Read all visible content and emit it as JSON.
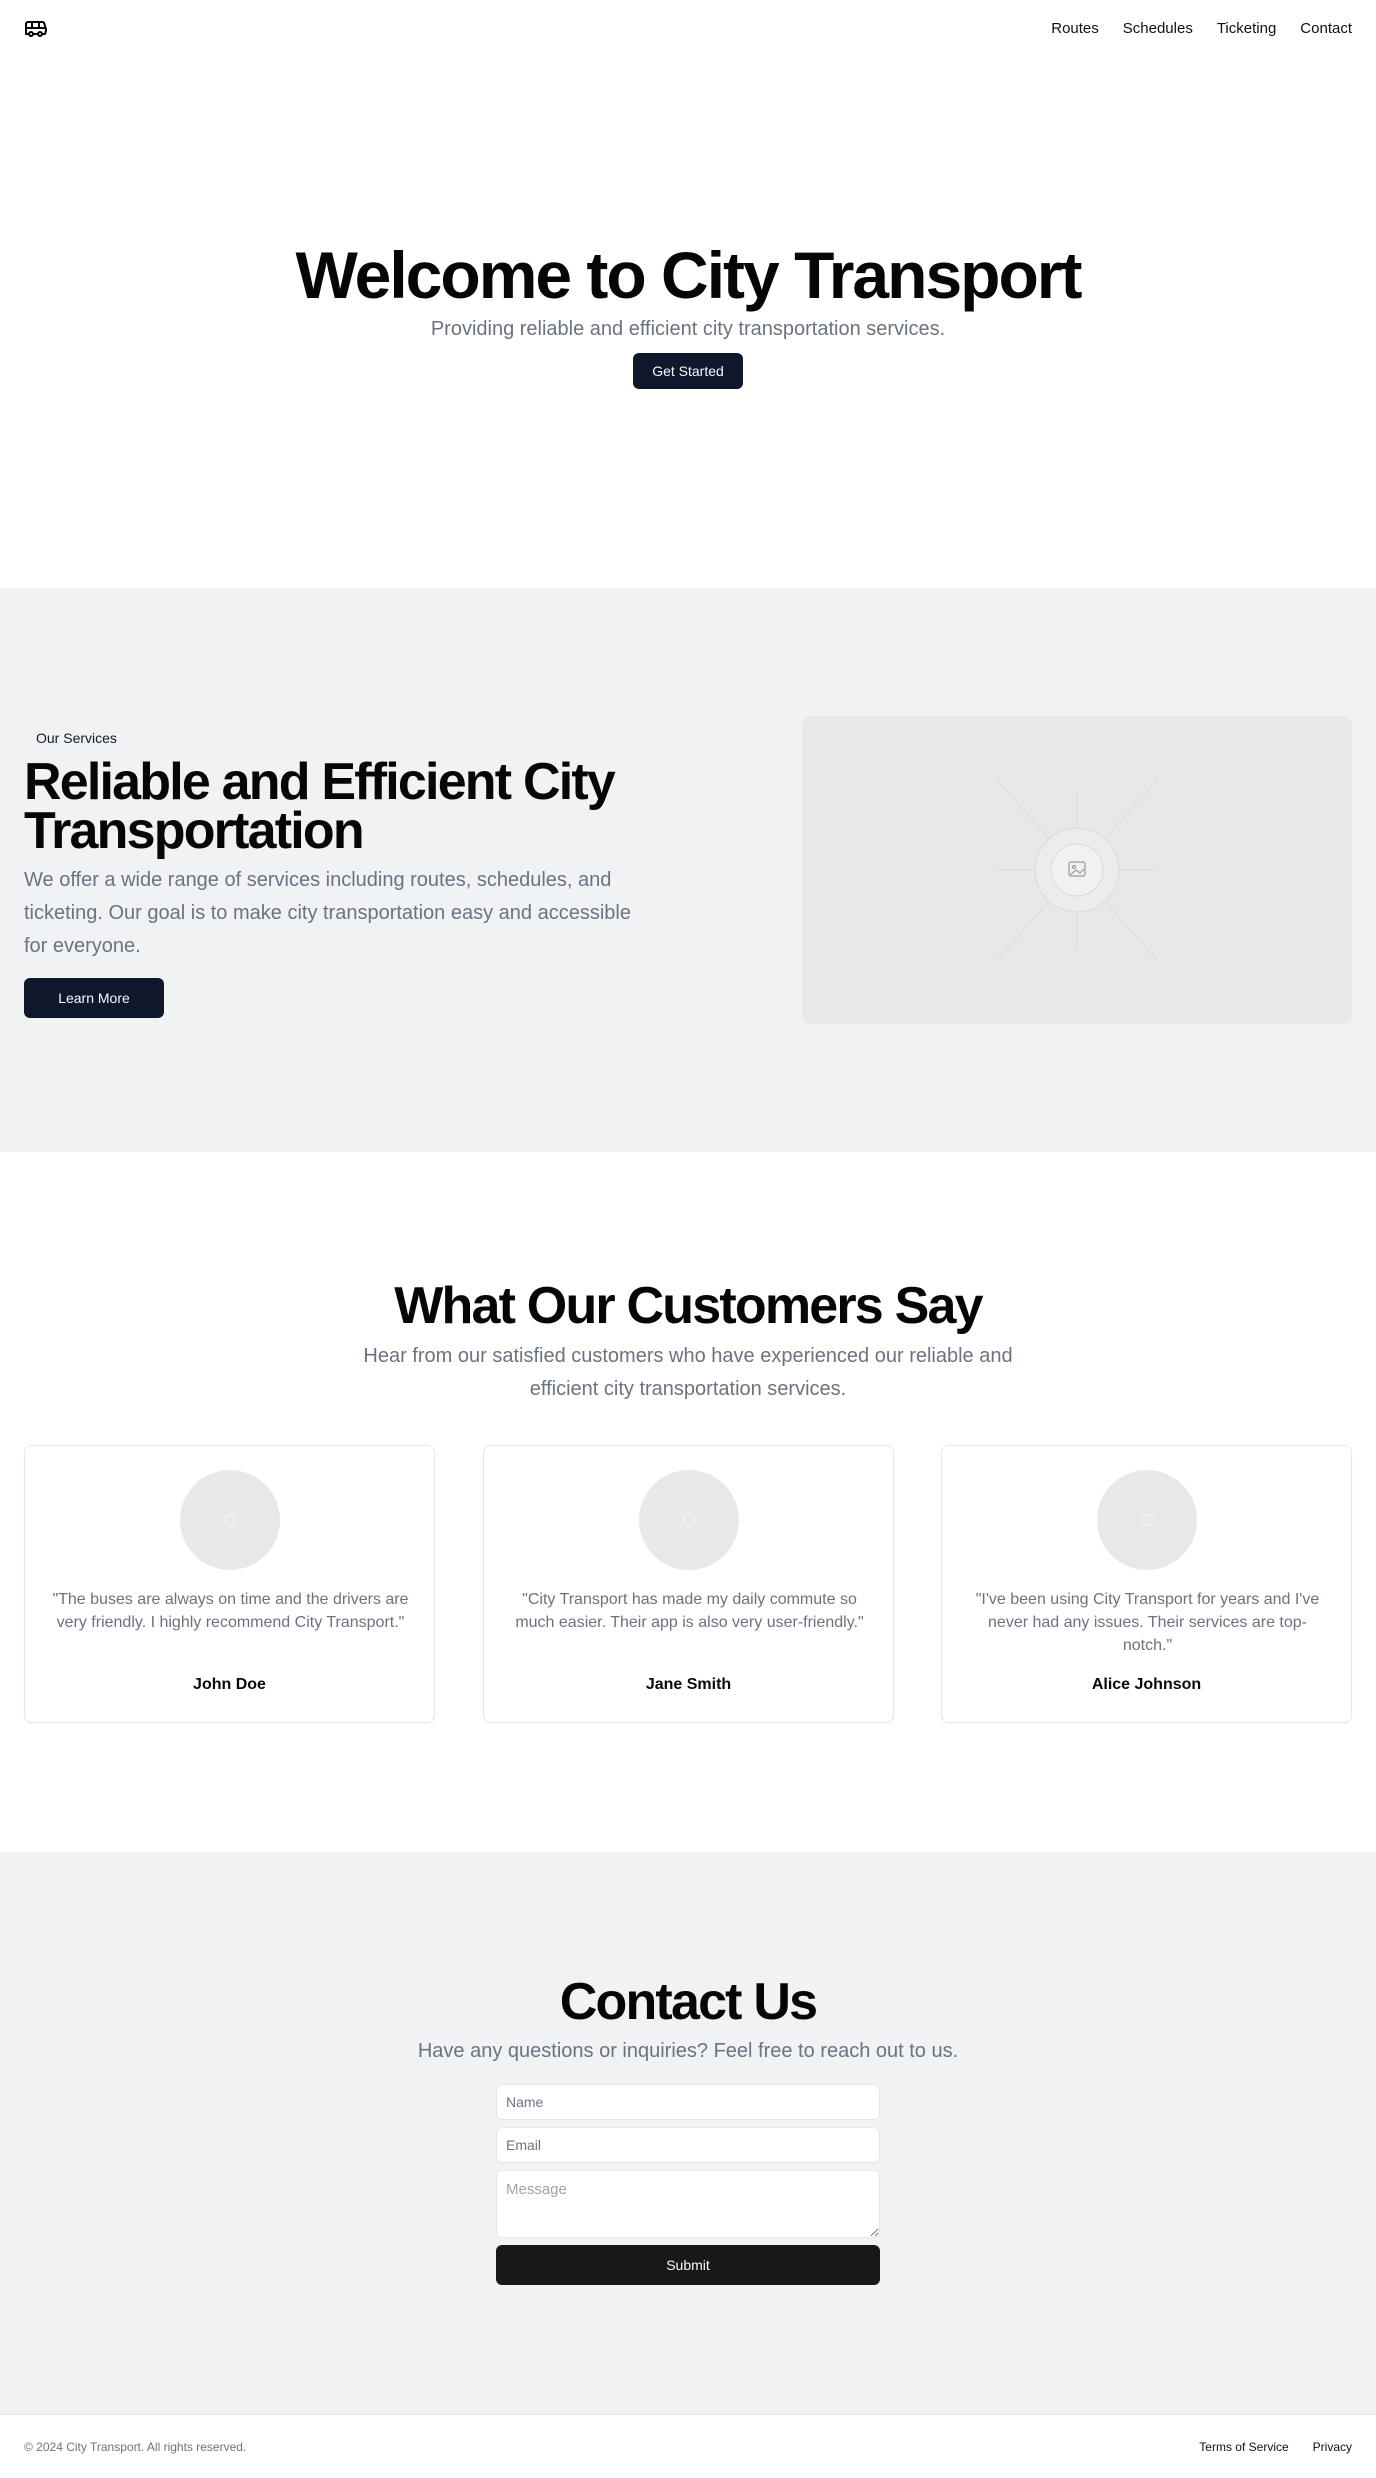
{
  "header": {
    "logo_icon": "bus-icon",
    "nav": [
      "Routes",
      "Schedules",
      "Ticketing",
      "Contact"
    ]
  },
  "hero": {
    "title": "Welcome to City Transport",
    "subtitle": "Providing reliable and efficient city transportation services.",
    "cta": "Get Started"
  },
  "services": {
    "badge": "Our Services",
    "title": "Reliable and Efficient City Transportation",
    "text": "We offer a wide range of services including routes, schedules, and ticketing. Our goal is to make city transportation easy and accessible for everyone.",
    "cta": "Learn More",
    "image_icon": "image-placeholder-icon"
  },
  "testimonials": {
    "title": "What Our Customers Say",
    "subtitle": "Hear from our satisfied customers who have experienced our reliable and efficient city transportation services.",
    "items": [
      {
        "quote": "\"The buses are always on time and the drivers are very friendly. I highly recommend City Transport.\"",
        "name": "John Doe"
      },
      {
        "quote": "\"City Transport has made my daily commute so much easier. Their app is also very user-friendly.\"",
        "name": "Jane Smith"
      },
      {
        "quote": "\"I've been using City Transport for years and I've never had any issues. Their services are top-notch.\"",
        "name": "Alice Johnson"
      }
    ]
  },
  "contact": {
    "title": "Contact Us",
    "subtitle": "Have any questions or inquiries? Feel free to reach out to us.",
    "name_placeholder": "Name",
    "email_placeholder": "Email",
    "message_placeholder": "Message",
    "submit": "Submit"
  },
  "footer": {
    "copyright": "© 2024 City Transport. All rights reserved.",
    "links": [
      "Terms of Service",
      "Privacy"
    ]
  },
  "colors": {
    "primary_button": "#0f172a",
    "submit_button": "#18181b",
    "section_gray": "#f1f2f4",
    "muted_text": "#6b7280"
  }
}
